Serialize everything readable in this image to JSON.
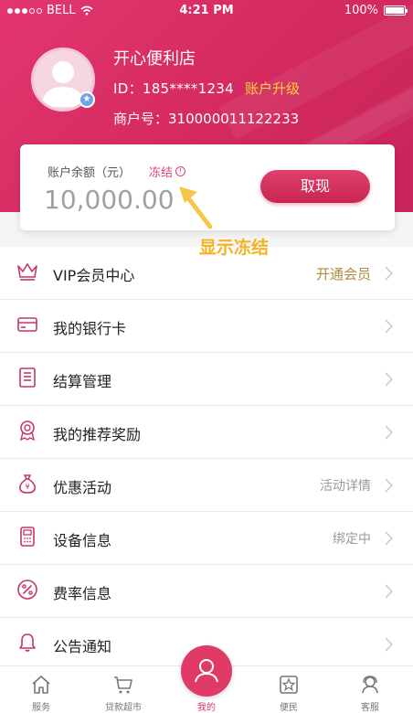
{
  "status_bar": {
    "carrier": "BELL",
    "time": "4:21 PM",
    "battery": "100%"
  },
  "profile": {
    "shop_name": "开心便利店",
    "id_text": "ID：185****1234",
    "upgrade_label": "账户升级",
    "merchant_text": "商户号：310000011122233"
  },
  "balance": {
    "label": "账户余额（元）",
    "frozen_label": "冻结",
    "amount": "10,000.00",
    "withdraw_label": "取现"
  },
  "annotation": {
    "text": "显示冻结"
  },
  "menu": {
    "items": [
      {
        "label": "VIP会员中心",
        "right": "开通会员",
        "icon": "crown-icon"
      },
      {
        "label": "我的银行卡",
        "right": "",
        "icon": "bank-card-icon"
      },
      {
        "label": "结算管理",
        "right": "",
        "icon": "document-list-icon"
      },
      {
        "label": "我的推荐奖励",
        "right": "",
        "icon": "award-medal-icon"
      },
      {
        "label": "优惠活动",
        "right": "活动详情",
        "icon": "money-bag-icon"
      },
      {
        "label": "设备信息",
        "right": "绑定中",
        "icon": "pos-device-icon"
      },
      {
        "label": "费率信息",
        "right": "",
        "icon": "percent-icon"
      },
      {
        "label": "公告通知",
        "right": "",
        "icon": "bell-icon"
      }
    ]
  },
  "tabbar": {
    "items": [
      {
        "label": "服务",
        "icon": "home-icon"
      },
      {
        "label": "贷款超市",
        "icon": "shopping-cart-icon"
      },
      {
        "label": "我的",
        "icon": "user-icon"
      },
      {
        "label": "便民",
        "icon": "star-frame-icon"
      },
      {
        "label": "客服",
        "icon": "headset-icon"
      }
    ]
  },
  "colors": {
    "brand": "#d8306a",
    "accent_gold": "#ffd23a",
    "annotation": "#f6b21e"
  }
}
